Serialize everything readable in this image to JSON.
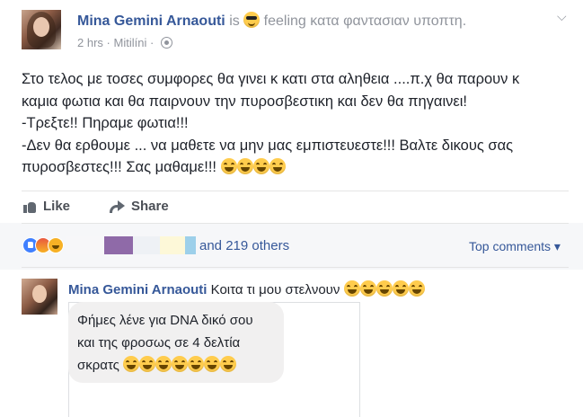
{
  "post": {
    "author": "Mina Gemini Arnaouti",
    "is_word": "is",
    "feeling_text": "feeling κατα φαντασιαν υποπτη.",
    "time": "2 hrs",
    "location": "Mitilíni",
    "dot": "·",
    "menu_icon": "chevron-down-icon",
    "lines": [
      "Στο τελος με τοσες συμφορες θα γινει κ κατι στα αληθεια ....π.χ θα παρουν κ",
      "καμια φωτια και θα παιρνουν την πυροσβεστικη και δεν θα πηγαινει!",
      "-Τρεξτε!! Πηραμε φωτια!!!",
      "-Δεν θα ερθουμε ... να μαθετε να μην μας εμπιστευεστε!!! Βαλτε δικους σας",
      "πυροσβεστες!!! Σας μαθαμε!!!"
    ]
  },
  "actions": {
    "like": "Like",
    "share": "Share"
  },
  "reactions": {
    "others_text": "and 219 others",
    "top_comments": "Top comments ▾",
    "colors": [
      "#4080ff",
      "#e9573f",
      "#f7b125"
    ]
  },
  "comment": {
    "author": "Mina Gemini Arnaouti",
    "text": "Κοιτα τι μου στελνουν",
    "bubble_lines": [
      "Φήμες λένε για DNA δικό σου",
      "και της φροσως σε 4 δελτία",
      "σκρατς"
    ]
  }
}
